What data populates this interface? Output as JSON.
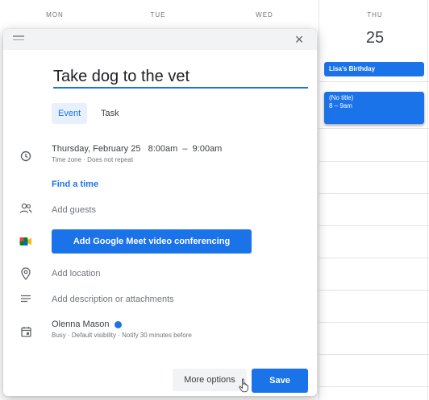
{
  "calendar": {
    "days": [
      "MON",
      "TUE",
      "WED",
      "THU"
    ],
    "thu_date": "25",
    "events": [
      {
        "title": "Lisa's Birthday"
      },
      {
        "title": "(No title)",
        "time": "8 – 9am"
      }
    ]
  },
  "dialog": {
    "close_icon": "close-icon",
    "title_value": "Take dog to the vet",
    "tabs": [
      "Event",
      "Task"
    ],
    "datetime": "Thursday, February 25   8:00am  –  9:00am",
    "datetime_sub": "Time zone · Does not repeat",
    "find_time": "Find a time",
    "add_guests": "Add guests",
    "meet_button": "Add Google Meet video conferencing",
    "add_location": "Add location",
    "add_description": "Add description or attachments",
    "owner": "Olenna Mason",
    "owner_sub": "Busy · Default visibility · Notify 30 minutes before",
    "more_options": "More options",
    "save": "Save"
  },
  "colors": {
    "accent": "#1a73e8",
    "event_bg": "#1a73e8",
    "tab_active_bg": "#e8f0fe"
  }
}
